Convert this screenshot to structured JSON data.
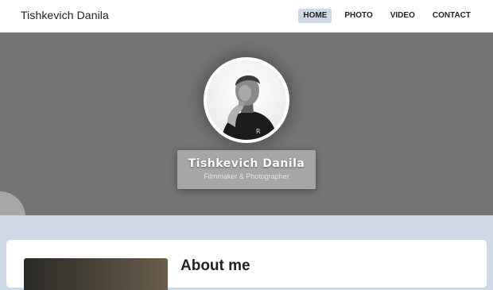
{
  "header": {
    "brand": "Tishkevich Danila",
    "nav": [
      {
        "label": "HOME",
        "active": true
      },
      {
        "label": "PHOTO",
        "active": false
      },
      {
        "label": "VIDEO",
        "active": false
      },
      {
        "label": "CONTACT",
        "active": false
      }
    ]
  },
  "hero": {
    "name": "Tishkevich Danila",
    "tagline": "Filmmaker & Photographer",
    "avatar_icon": "portrait-photo"
  },
  "about": {
    "title": "About me"
  },
  "colors": {
    "accent": "#cfd8e6",
    "hero_bg": "#747474"
  }
}
